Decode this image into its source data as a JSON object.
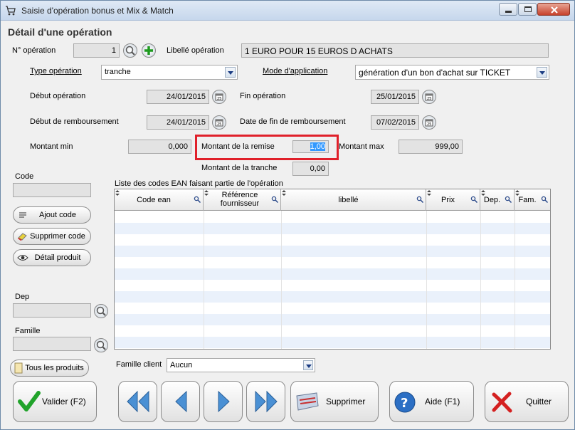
{
  "window": {
    "title": "Saisie d'opération bonus et Mix & Match"
  },
  "section_title": "Détail d'une opération",
  "fields": {
    "num_operation_label": "N° opération",
    "num_operation_value": "1",
    "libelle_label": "Libellé opération",
    "libelle_value": "1 EURO POUR 15 EUROS D ACHATS",
    "type_label": "Type opération",
    "type_value": "tranche",
    "mode_label": "Mode d'application",
    "mode_value": "génération d'un bon d'achat sur TICKET",
    "debut_op_label": "Début opération",
    "debut_op_value": "24/01/2015",
    "fin_op_label": "Fin opération",
    "fin_op_value": "25/01/2015",
    "debut_remb_label": "Début de remboursement",
    "debut_remb_value": "24/01/2015",
    "fin_remb_label": "Date de fin de remboursement",
    "fin_remb_value": "07/02/2015",
    "montant_min_label": "Montant min",
    "montant_min_value": "0,000",
    "montant_remise_label": "Montant de la remise",
    "montant_remise_value": "1,00",
    "montant_max_label": "Montant max",
    "montant_max_value": "999,00",
    "montant_tranche_label": "Montant de la tranche",
    "montant_tranche_value": "0,00"
  },
  "left_panel": {
    "code_label": "Code",
    "ajout_code": "Ajout code",
    "supprimer_code": "Supprimer code",
    "detail_produit": "Détail produit",
    "dep_label": "Dep",
    "famille_label": "Famille",
    "tous_produits": "Tous les produits"
  },
  "grid": {
    "caption": "Liste des codes EAN faisant partie de l'opération",
    "columns": [
      "Code ean",
      "Référence fournisseur",
      "libellé",
      "Prix",
      "Dep.",
      "Fam."
    ]
  },
  "famille_client": {
    "label": "Famille client",
    "value": "Aucun"
  },
  "buttons": {
    "valider": "Valider (F2)",
    "supprimer": "Supprimer",
    "aide": "Aide (F1)",
    "quitter": "Quitter"
  },
  "colors": {
    "highlight": "#e0202a",
    "selection": "#3399ff"
  }
}
